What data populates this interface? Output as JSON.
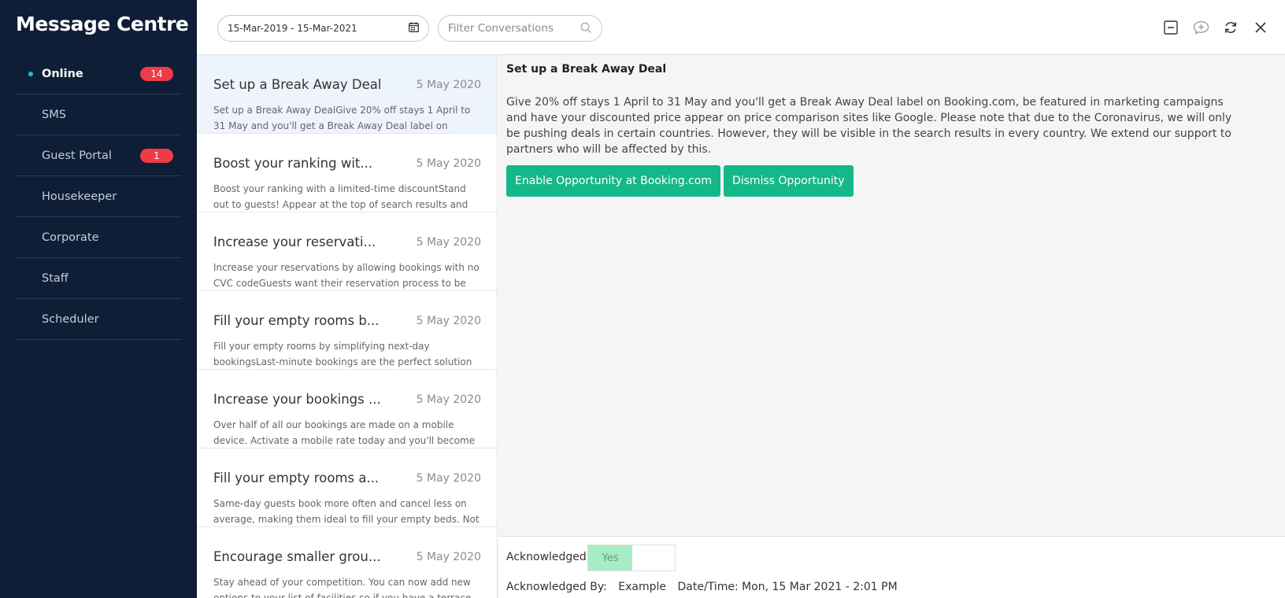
{
  "app": {
    "title": "Message Centre"
  },
  "sidebar": {
    "items": [
      {
        "label": "Online",
        "badge": "14",
        "active": true
      },
      {
        "label": "SMS"
      },
      {
        "label": "Guest Portal",
        "badge": "1"
      },
      {
        "label": "Housekeeper"
      },
      {
        "label": "Corporate"
      },
      {
        "label": "Staff"
      },
      {
        "label": "Scheduler"
      }
    ]
  },
  "toolbar": {
    "date_range": "15-Mar-2019 - 15-Mar-2021",
    "filter_placeholder": "Filter Conversations",
    "icons": [
      "minimize-icon",
      "new-message-icon",
      "refresh-icon",
      "close-icon"
    ]
  },
  "messages": [
    {
      "title": "Set up a Break Away Deal",
      "date": "5 May 2020",
      "preview": "Set up a Break Away DealGive 20% off stays 1 April to 31 May and you'll get a Break Away Deal label on Booking.com,"
    },
    {
      "title": "Boost your ranking wit...",
      "date": "5 May 2020",
      "preview": "Boost your ranking with a limited-time discountStand out to guests! Appear at the top of search results and increase your"
    },
    {
      "title": "Increase your reservati...",
      "date": "5 May 2020",
      "preview": "Increase your reservations by allowing bookings with no CVC codeGuests want their reservation process to be fast and"
    },
    {
      "title": "Fill your empty rooms b...",
      "date": "5 May 2020",
      "preview": "Fill your empty rooms by simplifying next-day bookingsLast-minute bookings are the perfect solution to empty rooms."
    },
    {
      "title": "Increase your bookings ...",
      "date": "5 May 2020",
      "preview": "Over half of all our bookings are made on a mobile device. Activate a mobile rate today and you'll become a top pick for"
    },
    {
      "title": "Fill your empty rooms a...",
      "date": "5 May 2020",
      "preview": "Same-day guests book more often and cancel less on average, making them ideal to fill your empty beds. Not"
    },
    {
      "title": "Encourage smaller grou...",
      "date": "5 May 2020",
      "preview": "Stay ahead of your competition. You can now add new options to your list of facilities so if you have a terrace in"
    }
  ],
  "detail": {
    "title": "Set up a Break Away Deal",
    "body": "Give 20% off stays 1 April to 31 May and you'll get a Break Away Deal label on Booking.com, be featured in marketing campaigns and have your discounted price appear on price comparison sites like Google. Please note that due to the Coronavirus, we will only be pushing deals in certain countries. However, they will be visible in the search results in every country. We extend our support to partners who will be affected by this.",
    "enable_label": "Enable Opportunity at Booking.com",
    "dismiss_label": "Dismiss Opportunity"
  },
  "footer": {
    "ack_label": "Acknowledged:",
    "ack_value": "Yes",
    "ack_by_label": "Acknowledged By:",
    "ack_by_value": "Example",
    "datetime": "Date/Time: Mon, 15 Mar 2021 - 2:01 PM"
  },
  "colors": {
    "sidebar_bg": "#0e1e36",
    "badge": "#ef3b46",
    "accent": "#14b889",
    "toggle_on": "#a6ecc4",
    "online_dot": "#1fb7e0"
  }
}
